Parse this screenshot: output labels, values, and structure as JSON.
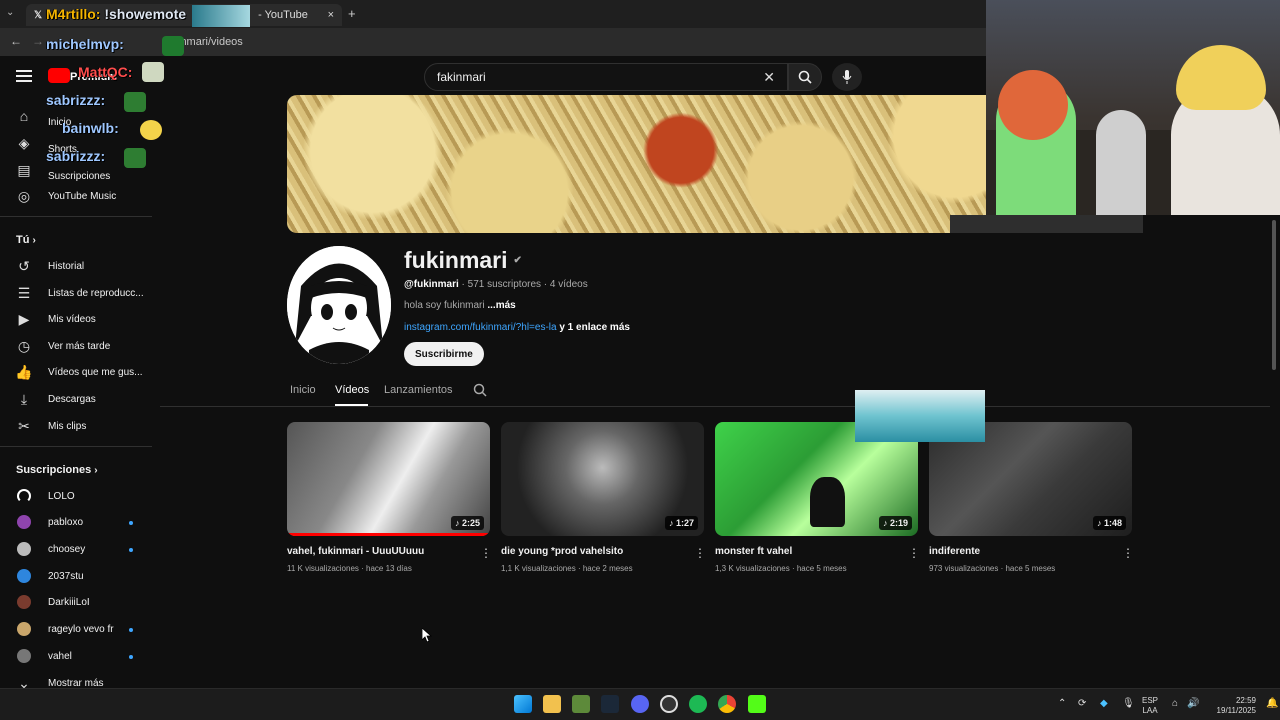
{
  "browser": {
    "tab_title": "- YouTube",
    "url": "inmari/videos",
    "new_tab": "+",
    "close_tab": "×"
  },
  "header": {
    "search_value": "fakinmari",
    "premium_label": "Premium"
  },
  "sidebar": {
    "main_items": [
      {
        "label": "Inicio"
      },
      {
        "label": "Shorts"
      },
      {
        "label": "Suscripciones"
      },
      {
        "label": "YouTube Music"
      }
    ],
    "you_header": "Tú",
    "you_items": [
      {
        "label": "Historial"
      },
      {
        "label": "Listas de reproducc..."
      },
      {
        "label": "Mis vídeos"
      },
      {
        "label": "Ver más tarde"
      },
      {
        "label": "Vídeos que me gus..."
      },
      {
        "label": "Descargas"
      },
      {
        "label": "Mis clips"
      }
    ],
    "subs_header": "Suscripciones",
    "subs": [
      {
        "label": "LOLO",
        "color": "#ffffff"
      },
      {
        "label": "pabloxo",
        "color": "#8e44ad"
      },
      {
        "label": "choosey",
        "color": "#bbbbbb"
      },
      {
        "label": "2037stu",
        "color": "#2e86de"
      },
      {
        "label": "DarkiiiLoI",
        "color": "#7a3b2e"
      },
      {
        "label": "rageylo vevo fr",
        "color": "#c9a66b"
      },
      {
        "label": "vahel",
        "color": "#777777"
      }
    ],
    "show_more": "Mostrar más"
  },
  "channel": {
    "name": "fukinmari",
    "handle": "@fukinmari",
    "stats": "· 571 suscriptores · 4 vídeos",
    "description": "hola soy fukinmari",
    "description_more": "...más",
    "link": "instagram.com/fukinmari/?hl=es-la",
    "link_more": "y 1 enlace más",
    "subscribe": "Suscribirme",
    "tabs": [
      "Inicio",
      "Vídeos",
      "Lanzamientos"
    ]
  },
  "videos": [
    {
      "title": "vahel, fukinmari - UuuUUuuu",
      "views": "11 K visualizaciones",
      "age": "hace 13 días",
      "duration": "2:25"
    },
    {
      "title": "die young *prod vahelsito",
      "views": "1,1 K visualizaciones",
      "age": "hace 2 meses",
      "duration": "1:27"
    },
    {
      "title": "monster ft vahel",
      "views": "1,3 K visualizaciones",
      "age": "hace 5 meses",
      "duration": "2:19"
    },
    {
      "title": "indiferente",
      "views": "973 visualizaciones",
      "age": "hace 5 meses",
      "duration": "1:48"
    }
  ],
  "chat_overlay": [
    {
      "user": "M4rtillo:",
      "msg": "!showemote"
    },
    {
      "user": "michelmvp:",
      "msg": ""
    },
    {
      "user": "MattQC:",
      "msg": ""
    },
    {
      "user": "sabrizzz:",
      "msg": ""
    },
    {
      "user": "bainwlb:",
      "msg": ""
    },
    {
      "user": "sabrizzz:",
      "msg": ""
    }
  ],
  "taskbar": {
    "lang": "ESP",
    "lang2": "LAA",
    "time": "22:59",
    "date": "19/11/2025"
  }
}
